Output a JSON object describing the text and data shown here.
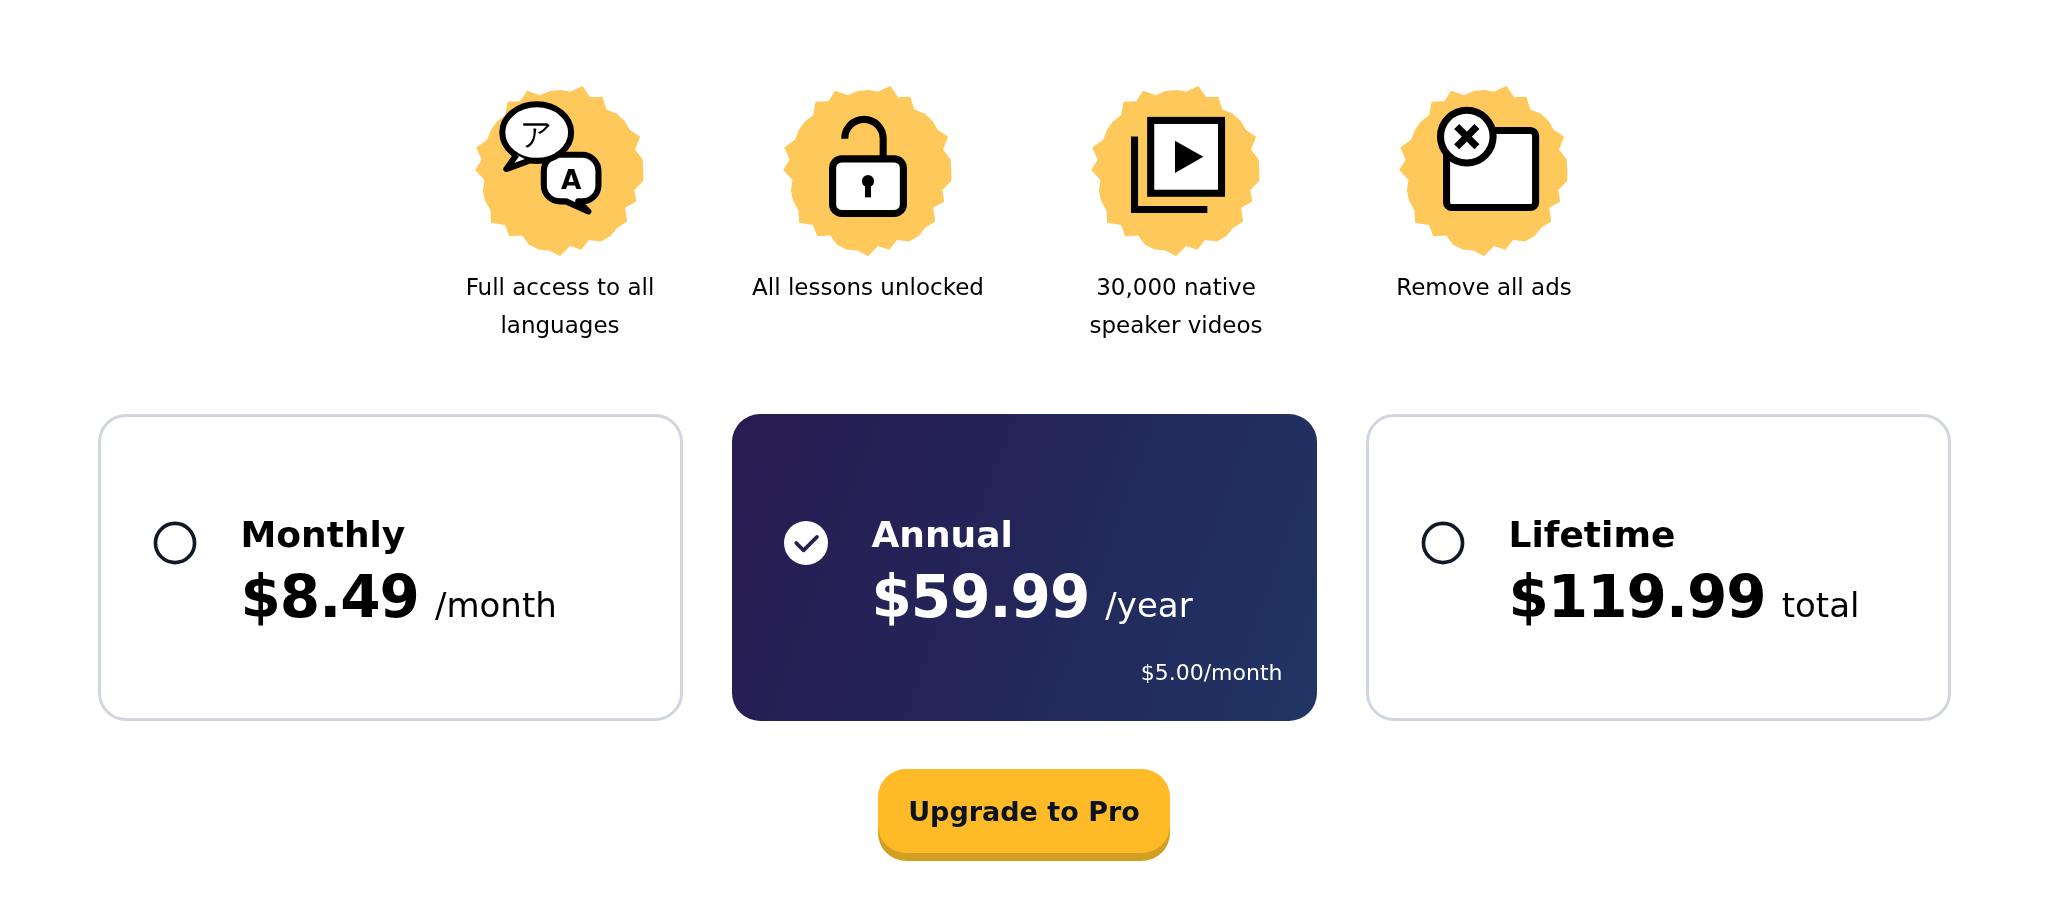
{
  "features": [
    {
      "label": "Full access to all languages",
      "glyphs": [
        "ア",
        "A"
      ]
    },
    {
      "label": "All lessons unlocked"
    },
    {
      "label": "30,000 native speaker videos"
    },
    {
      "label": "Remove all ads"
    }
  ],
  "plans": [
    {
      "name": "Monthly",
      "price": "$8.49",
      "unit": "/month",
      "selected": false
    },
    {
      "name": "Annual",
      "price": "$59.99",
      "unit": "/year",
      "note": "$5.00/month",
      "selected": true
    },
    {
      "name": "Lifetime",
      "price": "$119.99",
      "unit": "total",
      "selected": false
    }
  ],
  "button": {
    "label": "Upgrade to Pro"
  }
}
